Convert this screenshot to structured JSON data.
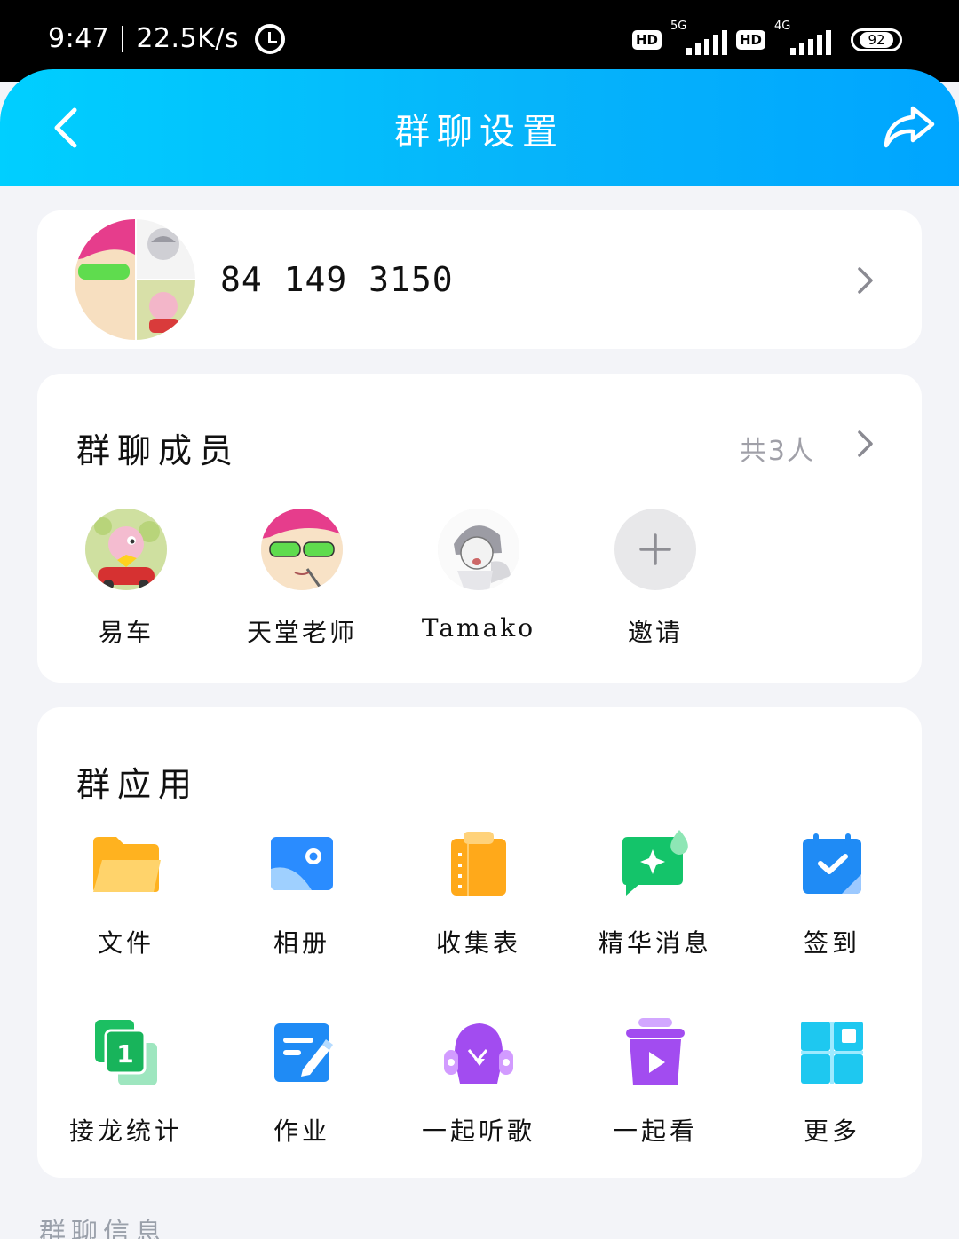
{
  "status_bar": {
    "time": "9:47",
    "net_speed": "22.5K/s",
    "hd1": "HD",
    "gen1": "5G",
    "hd2": "HD",
    "gen2": "4G",
    "battery": "92",
    "alarm_icon": "alarm-icon"
  },
  "header": {
    "title": "群聊设置",
    "back_icon": "back-arrow-icon",
    "share_icon": "share-icon",
    "gradient_start": "#00cfff",
    "gradient_end": "#00a5ff"
  },
  "group": {
    "id": "84 149 3150"
  },
  "members": {
    "title": "群聊成员",
    "count": "共3人",
    "list": [
      {
        "name": "易车"
      },
      {
        "name": "天堂老师"
      },
      {
        "name": "Tamako"
      }
    ],
    "invite_label": "邀请"
  },
  "apps": {
    "title": "群应用",
    "items": [
      {
        "label": "文件",
        "icon": "folder-icon"
      },
      {
        "label": "相册",
        "icon": "album-icon"
      },
      {
        "label": "收集表",
        "icon": "clipboard-icon"
      },
      {
        "label": "精华消息",
        "icon": "essence-message-icon"
      },
      {
        "label": "签到",
        "icon": "calendar-check-icon"
      },
      {
        "label": "接龙统计",
        "icon": "relay-count-icon"
      },
      {
        "label": "作业",
        "icon": "homework-icon"
      },
      {
        "label": "一起听歌",
        "icon": "listen-together-icon"
      },
      {
        "label": "一起看",
        "icon": "watch-together-icon"
      },
      {
        "label": "更多",
        "icon": "more-grid-icon"
      }
    ]
  },
  "info": {
    "title": "群聊信息"
  }
}
